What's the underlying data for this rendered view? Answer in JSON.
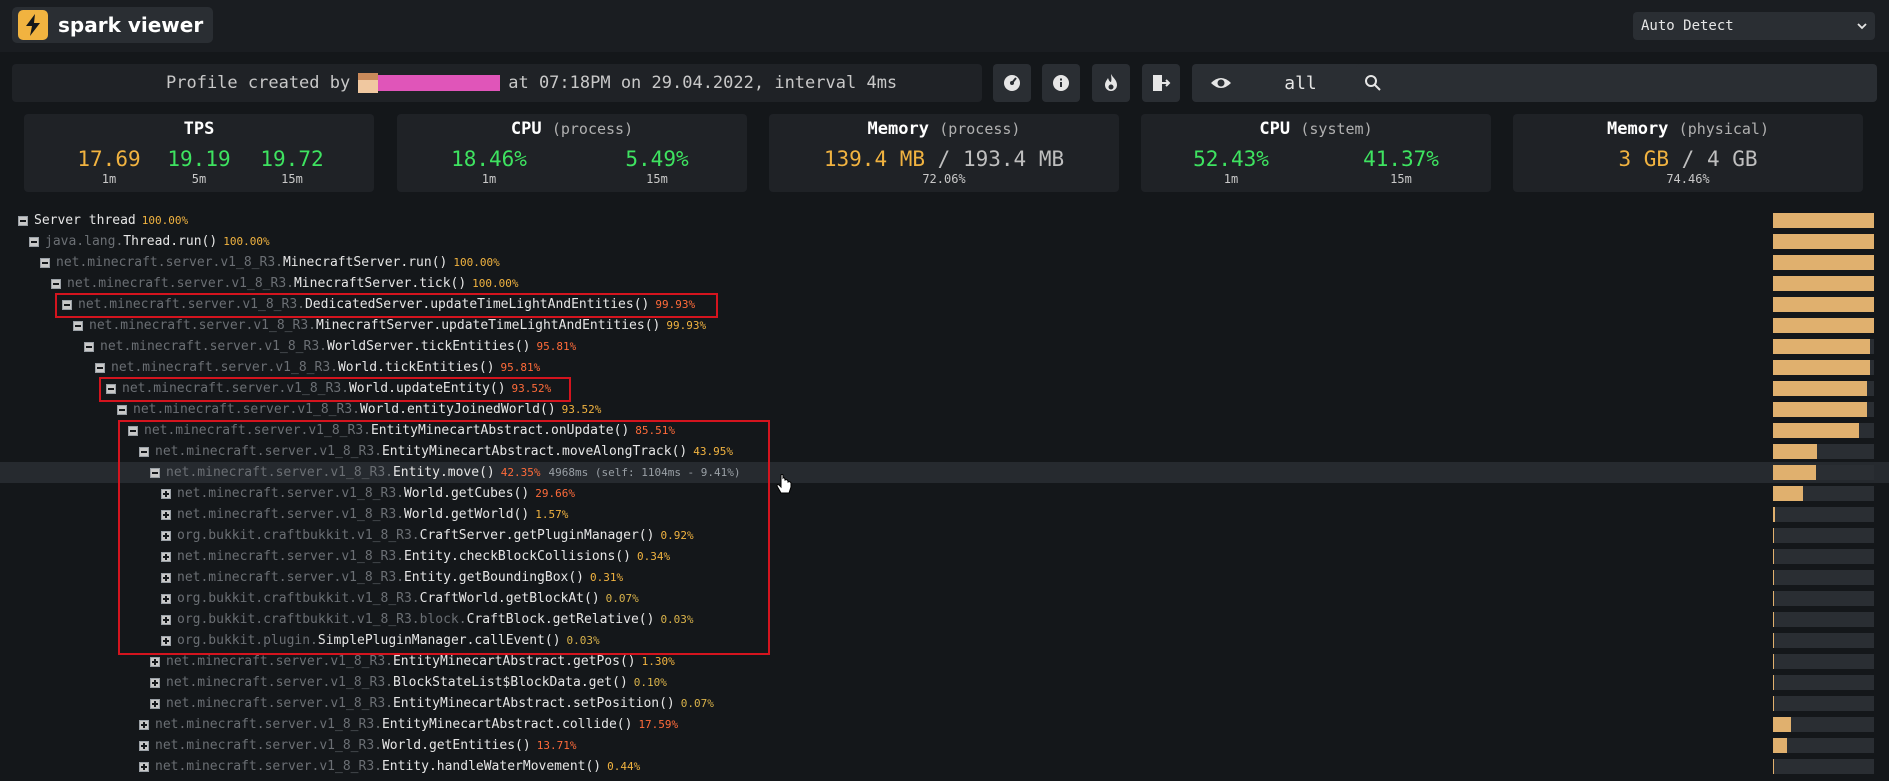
{
  "app": {
    "title": "spark viewer",
    "logo_icon": "lightning-bolt-icon"
  },
  "platform_select": {
    "value": "Auto Detect"
  },
  "info": {
    "prefix": "Profile created by",
    "suffix": "at 07:18PM on 29.04.2022, interval 4ms"
  },
  "toolbar": {
    "view_mode": "all"
  },
  "stats": {
    "tps": {
      "title": "TPS",
      "values": [
        {
          "v": "17.69",
          "l": "1m"
        },
        {
          "v": "19.19",
          "l": "5m"
        },
        {
          "v": "19.72",
          "l": "15m"
        }
      ]
    },
    "cpu_process": {
      "title": "CPU",
      "sub": "(process)",
      "values": [
        {
          "v": "18.46%",
          "l": "1m"
        },
        {
          "v": "5.49%",
          "l": "15m"
        }
      ]
    },
    "memory_process": {
      "title": "Memory",
      "sub": "(process)",
      "used": "139.4 MB",
      "total": "193.4 MB",
      "percent": "72.06%"
    },
    "cpu_system": {
      "title": "CPU",
      "sub": "(system)",
      "values": [
        {
          "v": "52.43%",
          "l": "1m"
        },
        {
          "v": "41.37%",
          "l": "15m"
        }
      ]
    },
    "memory_physical": {
      "title": "Memory",
      "sub": "(physical)",
      "used": "3 GB",
      "total": "4 GB",
      "percent": "74.46%"
    }
  },
  "tree": [
    {
      "pkg": "",
      "cls": "Server thread",
      "pct": "100.00%",
      "c": "o",
      "ratio": 1.0,
      "open": true
    },
    {
      "pkg": "java.lang.",
      "cls": "Thread.run()",
      "pct": "100.00%",
      "c": "o",
      "ratio": 1.0,
      "open": true
    },
    {
      "pkg": "net.minecraft.server.v1_8_R3.",
      "cls": "MinecraftServer.run()",
      "pct": "100.00%",
      "c": "o",
      "ratio": 1.0,
      "open": true
    },
    {
      "pkg": "net.minecraft.server.v1_8_R3.",
      "cls": "MinecraftServer.tick()",
      "pct": "100.00%",
      "c": "o",
      "ratio": 1.0,
      "open": true
    },
    {
      "pkg": "net.minecraft.server.v1_8_R3.",
      "cls": "DedicatedServer.updateTimeLightAndEntities()",
      "pct": "99.93%",
      "c": "r",
      "ratio": 0.999,
      "open": true
    },
    {
      "pkg": "net.minecraft.server.v1_8_R3.",
      "cls": "MinecraftServer.updateTimeLightAndEntities()",
      "pct": "99.93%",
      "c": "o",
      "ratio": 0.999,
      "open": true
    },
    {
      "pkg": "net.minecraft.server.v1_8_R3.",
      "cls": "WorldServer.tickEntities()",
      "pct": "95.81%",
      "c": "r",
      "ratio": 0.958,
      "open": true
    },
    {
      "pkg": "net.minecraft.server.v1_8_R3.",
      "cls": "World.tickEntities()",
      "pct": "95.81%",
      "c": "r",
      "ratio": 0.958,
      "open": true
    },
    {
      "pkg": "net.minecraft.server.v1_8_R3.",
      "cls": "World.updateEntity()",
      "pct": "93.52%",
      "c": "r",
      "ratio": 0.935,
      "open": true
    },
    {
      "pkg": "net.minecraft.server.v1_8_R3.",
      "cls": "World.entityJoinedWorld()",
      "pct": "93.52%",
      "c": "o",
      "ratio": 0.935,
      "open": true
    },
    {
      "pkg": "net.minecraft.server.v1_8_R3.",
      "cls": "EntityMinecartAbstract.onUpdate()",
      "pct": "85.51%",
      "c": "r",
      "ratio": 0.855,
      "open": true
    },
    {
      "pkg": "net.minecraft.server.v1_8_R3.",
      "cls": "EntityMinecartAbstract.moveAlongTrack()",
      "pct": "43.95%",
      "c": "o",
      "ratio": 0.44,
      "open": true
    },
    {
      "pkg": "net.minecraft.server.v1_8_R3.",
      "cls": "Entity.move()",
      "pct": "42.35%",
      "c": "r",
      "ratio": 0.424,
      "open": true,
      "extra": "4968ms (self: 1104ms - 9.41%)"
    },
    {
      "pkg": "net.minecraft.server.v1_8_R3.",
      "cls": "World.getCubes()",
      "pct": "29.66%",
      "c": "r",
      "ratio": 0.297,
      "open": false
    },
    {
      "pkg": "net.minecraft.server.v1_8_R3.",
      "cls": "World.getWorld()",
      "pct": "1.57%",
      "c": "o",
      "ratio": 0.016,
      "open": false
    },
    {
      "pkg": "org.bukkit.craftbukkit.v1_8_R3.",
      "cls": "CraftServer.getPluginManager()",
      "pct": "0.92%",
      "c": "o",
      "ratio": 0.009,
      "open": false
    },
    {
      "pkg": "net.minecraft.server.v1_8_R3.",
      "cls": "Entity.checkBlockCollisions()",
      "pct": "0.34%",
      "c": "o",
      "ratio": 0.003,
      "open": false
    },
    {
      "pkg": "net.minecraft.server.v1_8_R3.",
      "cls": "Entity.getBoundingBox()",
      "pct": "0.31%",
      "c": "o",
      "ratio": 0.003,
      "open": false
    },
    {
      "pkg": "org.bukkit.craftbukkit.v1_8_R3.",
      "cls": "CraftWorld.getBlockAt()",
      "pct": "0.07%",
      "c": "y",
      "ratio": 0.001,
      "open": false
    },
    {
      "pkg": "org.bukkit.craftbukkit.v1_8_R3.block.",
      "cls": "CraftBlock.getRelative()",
      "pct": "0.03%",
      "c": "y",
      "ratio": 0.0,
      "open": false
    },
    {
      "pkg": "org.bukkit.plugin.",
      "cls": "SimplePluginManager.callEvent()",
      "pct": "0.03%",
      "c": "y",
      "ratio": 0.0,
      "open": false
    },
    {
      "pkg": "net.minecraft.server.v1_8_R3.",
      "cls": "EntityMinecartAbstract.getPos()",
      "pct": "1.30%",
      "c": "o",
      "ratio": 0.013,
      "open": false
    },
    {
      "pkg": "net.minecraft.server.v1_8_R3.",
      "cls": "BlockStateList$BlockData.get()",
      "pct": "0.10%",
      "c": "y",
      "ratio": 0.001,
      "open": false
    },
    {
      "pkg": "net.minecraft.server.v1_8_R3.",
      "cls": "EntityMinecartAbstract.setPosition()",
      "pct": "0.07%",
      "c": "y",
      "ratio": 0.001,
      "open": false
    },
    {
      "pkg": "net.minecraft.server.v1_8_R3.",
      "cls": "EntityMinecartAbstract.collide()",
      "pct": "17.59%",
      "c": "r",
      "ratio": 0.176,
      "open": false
    },
    {
      "pkg": "net.minecraft.server.v1_8_R3.",
      "cls": "World.getEntities()",
      "pct": "13.71%",
      "c": "r",
      "ratio": 0.137,
      "open": false
    },
    {
      "pkg": "net.minecraft.server.v1_8_R3.",
      "cls": "Entity.handleWaterMovement()",
      "pct": "0.44%",
      "c": "o",
      "ratio": 0.004,
      "open": false
    }
  ]
}
